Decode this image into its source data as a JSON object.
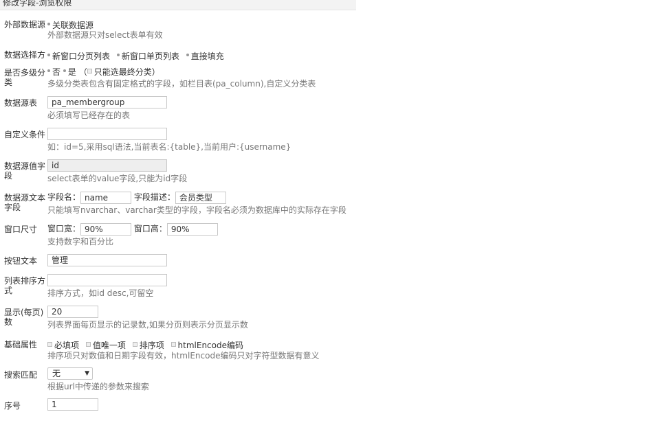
{
  "title": "修改字段-浏览权限",
  "rows": {
    "external": {
      "label": "外部数据源",
      "option": "关联数据源",
      "hint": "外部数据源只对select表单有效"
    },
    "select_mode": {
      "label": "数据选择方",
      "options": [
        "新窗口分页列表",
        "新窗口单页列表",
        "直接填充"
      ]
    },
    "multilevel": {
      "label": "是否多级分类",
      "no": "否",
      "yes": "是",
      "paren_open": "（",
      "leaf_only": "只能选最终分类",
      "paren_close": "）",
      "hint": "多级分类表包含有固定格式的字段，如栏目表(pa_column),自定义分类表"
    },
    "table": {
      "label": "数据源表",
      "value": "pa_membergroup",
      "hint": "必须填写已经存在的表"
    },
    "condition": {
      "label": "自定义条件",
      "value": "",
      "hint": "如：id=5,采用sql语法,当前表名:{table},当前用户:{username}"
    },
    "value_field": {
      "label": "数据源值字段",
      "value": "id",
      "hint": "select表单的value字段,只能为id字段"
    },
    "text_field": {
      "label": "数据源文本字段",
      "name_label": "字段名：",
      "name_value": "name",
      "desc_label": "字段描述：",
      "desc_value": "会员类型",
      "hint": "只能填写nvarchar、varchar类型的字段，字段名必须为数据库中的实际存在字段"
    },
    "window_size": {
      "label": "窗口尺寸",
      "width_label": "窗口宽：",
      "width_value": "90%",
      "height_label": "窗口高：",
      "height_value": "90%",
      "hint": "支持数字和百分比"
    },
    "button_text": {
      "label": "按钮文本",
      "value": "管理"
    },
    "sort": {
      "label": "列表排序方式",
      "value": "",
      "hint": "排序方式，如id desc,可留空"
    },
    "page_size": {
      "label": "显示(每页)数",
      "value": "20",
      "hint": "列表界面每页显示的记录数,如果分页则表示分页显示数"
    },
    "basic": {
      "label": "基础属性",
      "options": [
        "必填项",
        "值唯一项",
        "排序项",
        "htmlEncode编码"
      ],
      "hint": "排序项只对数值和日期字段有效，htmlEncode编码只对字符型数据有意义"
    },
    "search": {
      "label": "搜索匹配",
      "selected": "无",
      "hint": "根据url中传递的参数来搜索"
    },
    "order": {
      "label": "序号",
      "value": "1"
    }
  }
}
